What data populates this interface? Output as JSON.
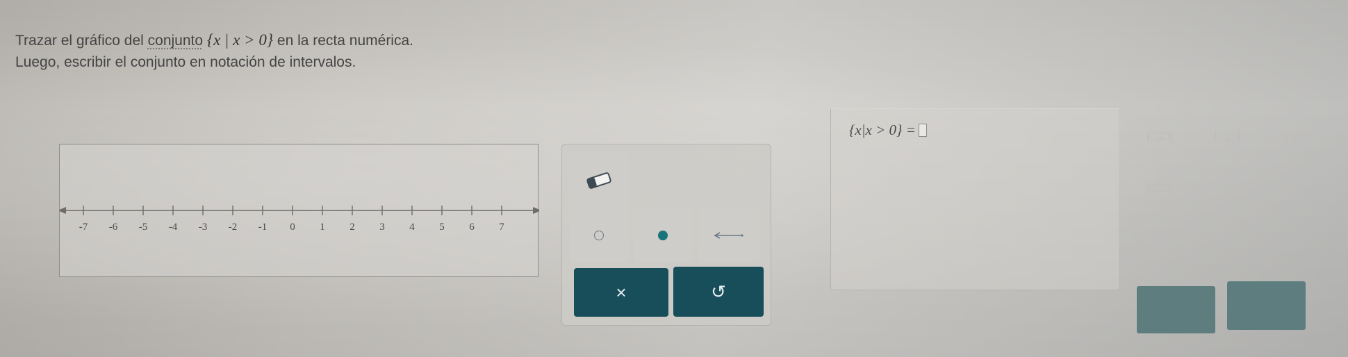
{
  "question": {
    "line1_pre": "Trazar el gráfico del",
    "line1_link": "conjunto",
    "line1_math": "{x | x > 0}",
    "line1_post": "en la recta numérica.",
    "line2": "Luego, escribir el conjunto en notación de intervalos."
  },
  "number_line": {
    "tick_labels": [
      "-7",
      "-6",
      "-5",
      "-4",
      "-3",
      "-2",
      "-1",
      "0",
      "1",
      "2",
      "3",
      "4",
      "5",
      "6",
      "7"
    ]
  },
  "tools": {
    "icons": {
      "eraser": "eraser-icon",
      "open": "open-endpoint-icon",
      "closed": "closed-endpoint-icon",
      "ray": "ray-icon",
      "clear": "x-icon",
      "undo": "undo-icon"
    },
    "clear_label": "×",
    "undo_label": "↺"
  },
  "answer": {
    "set_expr": "{x|x > 0} ="
  },
  "right_panel": {
    "items": [
      "(□,□)",
      "[□,□]",
      "[□,□)",
      "(□,□]",
      "∞",
      "-∞"
    ]
  },
  "colors": {
    "accent_dark": "#174e59",
    "closed_dot": "#18737a",
    "background": "#cccac6"
  }
}
